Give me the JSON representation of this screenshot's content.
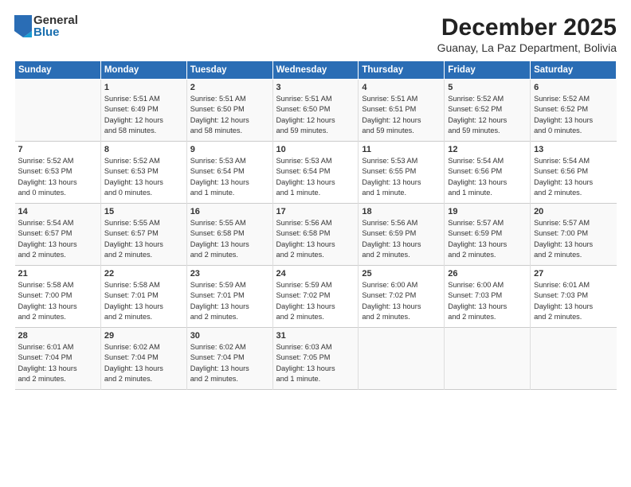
{
  "logo": {
    "general": "General",
    "blue": "Blue"
  },
  "title": "December 2025",
  "location": "Guanay, La Paz Department, Bolivia",
  "header_days": [
    "Sunday",
    "Monday",
    "Tuesday",
    "Wednesday",
    "Thursday",
    "Friday",
    "Saturday"
  ],
  "weeks": [
    [
      {
        "day": "",
        "info": ""
      },
      {
        "day": "1",
        "info": "Sunrise: 5:51 AM\nSunset: 6:49 PM\nDaylight: 12 hours\nand 58 minutes."
      },
      {
        "day": "2",
        "info": "Sunrise: 5:51 AM\nSunset: 6:50 PM\nDaylight: 12 hours\nand 58 minutes."
      },
      {
        "day": "3",
        "info": "Sunrise: 5:51 AM\nSunset: 6:50 PM\nDaylight: 12 hours\nand 59 minutes."
      },
      {
        "day": "4",
        "info": "Sunrise: 5:51 AM\nSunset: 6:51 PM\nDaylight: 12 hours\nand 59 minutes."
      },
      {
        "day": "5",
        "info": "Sunrise: 5:52 AM\nSunset: 6:52 PM\nDaylight: 12 hours\nand 59 minutes."
      },
      {
        "day": "6",
        "info": "Sunrise: 5:52 AM\nSunset: 6:52 PM\nDaylight: 13 hours\nand 0 minutes."
      }
    ],
    [
      {
        "day": "7",
        "info": "Sunrise: 5:52 AM\nSunset: 6:53 PM\nDaylight: 13 hours\nand 0 minutes."
      },
      {
        "day": "8",
        "info": "Sunrise: 5:52 AM\nSunset: 6:53 PM\nDaylight: 13 hours\nand 0 minutes."
      },
      {
        "day": "9",
        "info": "Sunrise: 5:53 AM\nSunset: 6:54 PM\nDaylight: 13 hours\nand 1 minute."
      },
      {
        "day": "10",
        "info": "Sunrise: 5:53 AM\nSunset: 6:54 PM\nDaylight: 13 hours\nand 1 minute."
      },
      {
        "day": "11",
        "info": "Sunrise: 5:53 AM\nSunset: 6:55 PM\nDaylight: 13 hours\nand 1 minute."
      },
      {
        "day": "12",
        "info": "Sunrise: 5:54 AM\nSunset: 6:56 PM\nDaylight: 13 hours\nand 1 minute."
      },
      {
        "day": "13",
        "info": "Sunrise: 5:54 AM\nSunset: 6:56 PM\nDaylight: 13 hours\nand 2 minutes."
      }
    ],
    [
      {
        "day": "14",
        "info": "Sunrise: 5:54 AM\nSunset: 6:57 PM\nDaylight: 13 hours\nand 2 minutes."
      },
      {
        "day": "15",
        "info": "Sunrise: 5:55 AM\nSunset: 6:57 PM\nDaylight: 13 hours\nand 2 minutes."
      },
      {
        "day": "16",
        "info": "Sunrise: 5:55 AM\nSunset: 6:58 PM\nDaylight: 13 hours\nand 2 minutes."
      },
      {
        "day": "17",
        "info": "Sunrise: 5:56 AM\nSunset: 6:58 PM\nDaylight: 13 hours\nand 2 minutes."
      },
      {
        "day": "18",
        "info": "Sunrise: 5:56 AM\nSunset: 6:59 PM\nDaylight: 13 hours\nand 2 minutes."
      },
      {
        "day": "19",
        "info": "Sunrise: 5:57 AM\nSunset: 6:59 PM\nDaylight: 13 hours\nand 2 minutes."
      },
      {
        "day": "20",
        "info": "Sunrise: 5:57 AM\nSunset: 7:00 PM\nDaylight: 13 hours\nand 2 minutes."
      }
    ],
    [
      {
        "day": "21",
        "info": "Sunrise: 5:58 AM\nSunset: 7:00 PM\nDaylight: 13 hours\nand 2 minutes."
      },
      {
        "day": "22",
        "info": "Sunrise: 5:58 AM\nSunset: 7:01 PM\nDaylight: 13 hours\nand 2 minutes."
      },
      {
        "day": "23",
        "info": "Sunrise: 5:59 AM\nSunset: 7:01 PM\nDaylight: 13 hours\nand 2 minutes."
      },
      {
        "day": "24",
        "info": "Sunrise: 5:59 AM\nSunset: 7:02 PM\nDaylight: 13 hours\nand 2 minutes."
      },
      {
        "day": "25",
        "info": "Sunrise: 6:00 AM\nSunset: 7:02 PM\nDaylight: 13 hours\nand 2 minutes."
      },
      {
        "day": "26",
        "info": "Sunrise: 6:00 AM\nSunset: 7:03 PM\nDaylight: 13 hours\nand 2 minutes."
      },
      {
        "day": "27",
        "info": "Sunrise: 6:01 AM\nSunset: 7:03 PM\nDaylight: 13 hours\nand 2 minutes."
      }
    ],
    [
      {
        "day": "28",
        "info": "Sunrise: 6:01 AM\nSunset: 7:04 PM\nDaylight: 13 hours\nand 2 minutes."
      },
      {
        "day": "29",
        "info": "Sunrise: 6:02 AM\nSunset: 7:04 PM\nDaylight: 13 hours\nand 2 minutes."
      },
      {
        "day": "30",
        "info": "Sunrise: 6:02 AM\nSunset: 7:04 PM\nDaylight: 13 hours\nand 2 minutes."
      },
      {
        "day": "31",
        "info": "Sunrise: 6:03 AM\nSunset: 7:05 PM\nDaylight: 13 hours\nand 1 minute."
      },
      {
        "day": "",
        "info": ""
      },
      {
        "day": "",
        "info": ""
      },
      {
        "day": "",
        "info": ""
      }
    ]
  ]
}
